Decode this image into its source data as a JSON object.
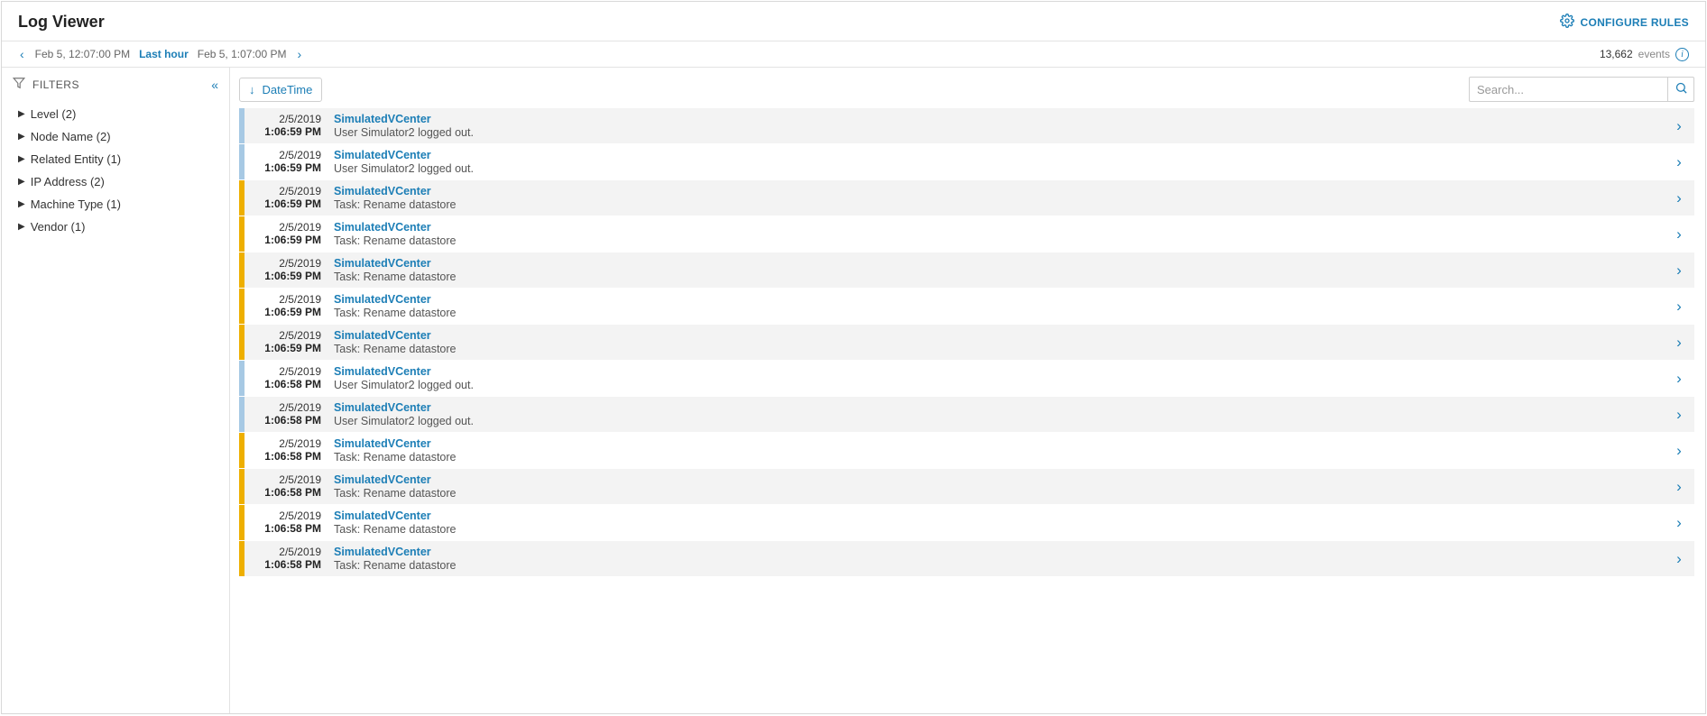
{
  "header": {
    "title": "Log Viewer",
    "configure_label": "CONFIGURE RULES"
  },
  "timebar": {
    "prev_time": "Feb 5, 12:07:00 PM",
    "range_label": "Last hour",
    "next_time": "Feb 5, 1:07:00 PM",
    "events_count": "13,662",
    "events_label": "events"
  },
  "sidebar": {
    "title": "FILTERS",
    "items": [
      {
        "label": "Level (2)"
      },
      {
        "label": "Node Name (2)"
      },
      {
        "label": "Related Entity (1)"
      },
      {
        "label": "IP Address (2)"
      },
      {
        "label": "Machine Type (1)"
      },
      {
        "label": "Vendor (1)"
      }
    ]
  },
  "toolbar": {
    "sort_label": "DateTime",
    "search_placeholder": "Search..."
  },
  "logs": [
    {
      "level": "info",
      "date": "2/5/2019",
      "time": "1:06:59 PM",
      "source": "SimulatedVCenter",
      "message": "User Simulator2 logged out."
    },
    {
      "level": "info",
      "date": "2/5/2019",
      "time": "1:06:59 PM",
      "source": "SimulatedVCenter",
      "message": "User Simulator2 logged out."
    },
    {
      "level": "warning",
      "date": "2/5/2019",
      "time": "1:06:59 PM",
      "source": "SimulatedVCenter",
      "message": "Task: Rename datastore"
    },
    {
      "level": "warning",
      "date": "2/5/2019",
      "time": "1:06:59 PM",
      "source": "SimulatedVCenter",
      "message": "Task: Rename datastore"
    },
    {
      "level": "warning",
      "date": "2/5/2019",
      "time": "1:06:59 PM",
      "source": "SimulatedVCenter",
      "message": "Task: Rename datastore"
    },
    {
      "level": "warning",
      "date": "2/5/2019",
      "time": "1:06:59 PM",
      "source": "SimulatedVCenter",
      "message": "Task: Rename datastore"
    },
    {
      "level": "warning",
      "date": "2/5/2019",
      "time": "1:06:59 PM",
      "source": "SimulatedVCenter",
      "message": "Task: Rename datastore"
    },
    {
      "level": "info",
      "date": "2/5/2019",
      "time": "1:06:58 PM",
      "source": "SimulatedVCenter",
      "message": "User Simulator2 logged out."
    },
    {
      "level": "info",
      "date": "2/5/2019",
      "time": "1:06:58 PM",
      "source": "SimulatedVCenter",
      "message": "User Simulator2 logged out."
    },
    {
      "level": "warning",
      "date": "2/5/2019",
      "time": "1:06:58 PM",
      "source": "SimulatedVCenter",
      "message": "Task: Rename datastore"
    },
    {
      "level": "warning",
      "date": "2/5/2019",
      "time": "1:06:58 PM",
      "source": "SimulatedVCenter",
      "message": "Task: Rename datastore"
    },
    {
      "level": "warning",
      "date": "2/5/2019",
      "time": "1:06:58 PM",
      "source": "SimulatedVCenter",
      "message": "Task: Rename datastore"
    },
    {
      "level": "warning",
      "date": "2/5/2019",
      "time": "1:06:58 PM",
      "source": "SimulatedVCenter",
      "message": "Task: Rename datastore"
    }
  ],
  "colors": {
    "accent": "#1c7eb6",
    "info_bar": "#a7c9e4",
    "warning_bar": "#eeaf00"
  }
}
